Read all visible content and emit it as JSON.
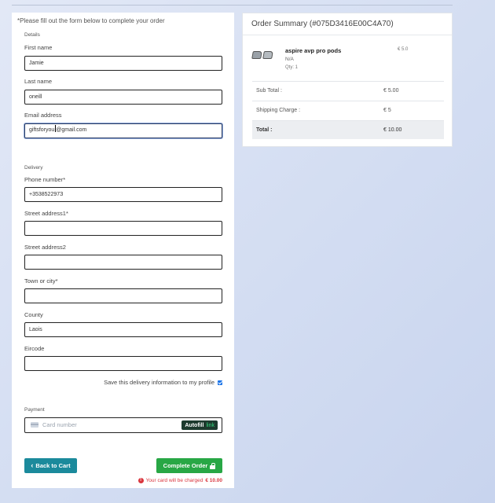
{
  "form": {
    "notice": "*Please fill out the form below to complete your order",
    "details_label": "Details",
    "first_name": {
      "label": "First name",
      "value": "Jamie"
    },
    "last_name": {
      "label": "Last name",
      "value": "oneill"
    },
    "email": {
      "label": "Email address",
      "value_before_caret": "giftsforyou",
      "value_after_caret": "@gmail.com"
    },
    "delivery_label": "Delivery",
    "phone": {
      "label": "Phone number*",
      "value": "+353852297З"
    },
    "street1": {
      "label": "Street address1*",
      "value": ""
    },
    "street2": {
      "label": "Street address2",
      "value": ""
    },
    "town": {
      "label": "Town or city*",
      "value": ""
    },
    "county": {
      "label": "County",
      "value": "Laois"
    },
    "eircode": {
      "label": "Eircode",
      "value": ""
    },
    "save_delivery": {
      "label": "Save this delivery information to my profile",
      "checked": true
    },
    "payment_label": "Payment",
    "card_placeholder": "Card number",
    "autofill": {
      "text": "Autofill",
      "link": "link"
    },
    "back_button": "Back to Cart",
    "complete_button": "Complete Order",
    "charge_note": "Your card will be charged",
    "charge_amount": "€ 10.00"
  },
  "summary": {
    "title": "Order Summary (#075D3416E00C4A70)",
    "item": {
      "name": "aspire avp pro pods",
      "variant": "N/A",
      "qty": "Qty: 1",
      "price": "€ 5.0"
    },
    "rows": [
      {
        "label": "Sub Total :",
        "value": "€ 5.00"
      },
      {
        "label": "Shipping Charge :",
        "value": "€ 5"
      },
      {
        "label": "Total :",
        "value": "€ 10.00"
      }
    ]
  },
  "colors": {
    "back_button": "#1b8a9c",
    "complete_button": "#28a745",
    "warning": "#d9363e",
    "checkbox": "#1a73e8"
  },
  "icons": [
    "chevron-left-icon",
    "lock-icon",
    "warning-icon",
    "card-icon",
    "checkbox-checked-icon"
  ]
}
